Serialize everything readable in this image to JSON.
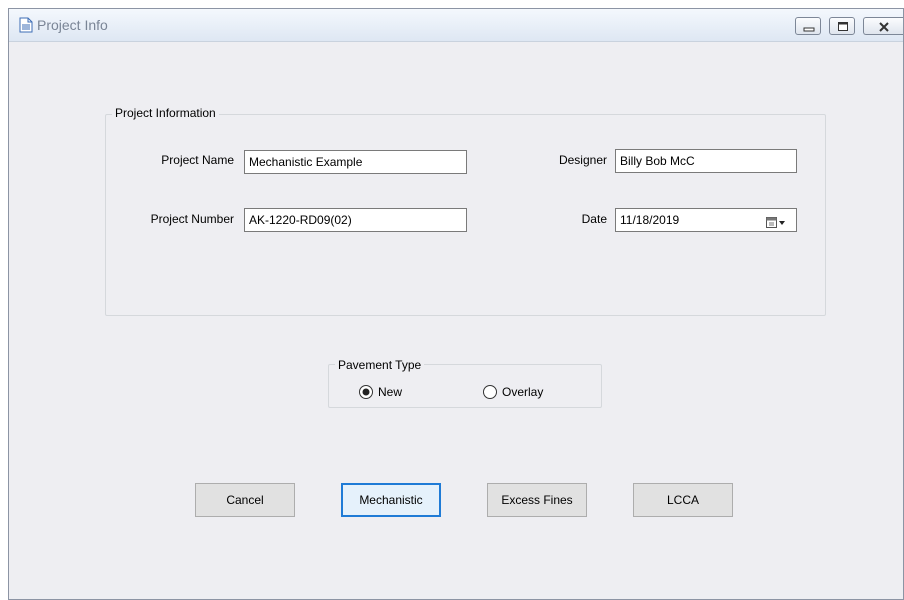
{
  "window": {
    "title": "Project Info"
  },
  "project_info": {
    "group_label": "Project Information",
    "project_name": {
      "label": "Project Name",
      "value": "Mechanistic Example"
    },
    "project_number": {
      "label": "Project Number",
      "value": "AK-1220-RD09(02)"
    },
    "designer": {
      "label": "Designer",
      "value": "Billy Bob McC"
    },
    "date": {
      "label": "Date",
      "value": "11/18/2019"
    }
  },
  "pavement_type": {
    "group_label": "Pavement Type",
    "options": [
      {
        "label": "New",
        "selected": true
      },
      {
        "label": "Overlay",
        "selected": false
      }
    ]
  },
  "buttons": {
    "cancel": "Cancel",
    "mechanistic": "Mechanistic",
    "excess_fines": "Excess Fines",
    "lcca": "LCCA"
  },
  "colors": {
    "accent": "#1f7bd6",
    "form_background": "#eeeef2"
  }
}
